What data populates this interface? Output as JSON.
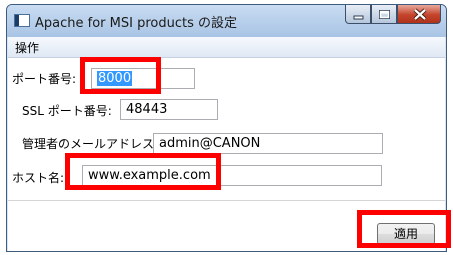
{
  "window": {
    "title": "Apache for MSI products の設定",
    "app_icon": "app-window-icon",
    "controls": [
      "minimize-icon",
      "maximize-icon",
      "close-icon"
    ]
  },
  "menu": {
    "items": [
      {
        "label": "操作"
      }
    ]
  },
  "form": {
    "port": {
      "label": "ポート番号:",
      "value": "8000"
    },
    "ssl_port": {
      "label": "SSL ポート番号:",
      "value": "48443"
    },
    "admin_email": {
      "label": "管理者のメールアドレス:",
      "value": "admin@CANON"
    },
    "host": {
      "label": "ホスト名:",
      "value": "www.example.com"
    }
  },
  "actions": {
    "apply_label": "適用"
  },
  "colors": {
    "highlight": "#ff0000",
    "selection": "#3399ff"
  }
}
